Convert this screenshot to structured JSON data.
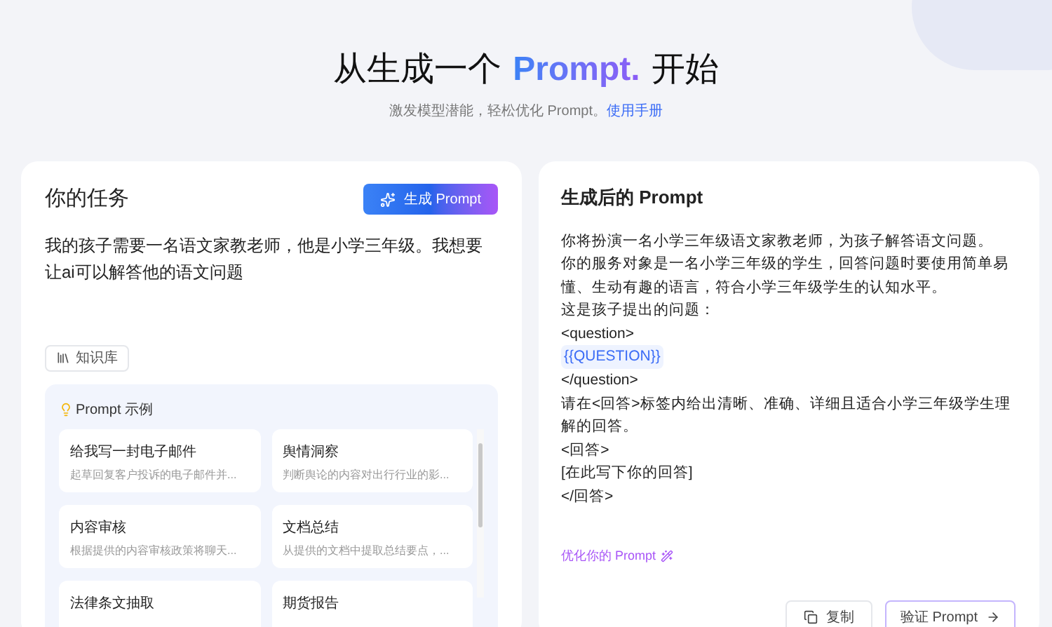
{
  "hero": {
    "title_before": "从生成一个",
    "title_highlight": "Prompt.",
    "title_after": "开始",
    "subtitle": "激发模型潜能，轻松优化 Prompt。",
    "manual_link": "使用手册"
  },
  "task_panel": {
    "title": "你的任务",
    "generate_button": "生成 Prompt",
    "task_text": "我的孩子需要一名语文家教老师，他是小学三年级。我想要让ai可以解答他的语文问题",
    "knowledge_button": "知识库",
    "examples": {
      "title": "Prompt 示例",
      "items": [
        {
          "title": "给我写一封电子邮件",
          "description": "起草回复客户投诉的电子邮件并..."
        },
        {
          "title": "舆情洞察",
          "description": "判断舆论的内容对出行行业的影..."
        },
        {
          "title": "内容审核",
          "description": "根据提供的内容审核政策将聊天..."
        },
        {
          "title": "文档总结",
          "description": "从提供的文档中提取总结要点，..."
        },
        {
          "title": "法律条文抽取"
        },
        {
          "title": "期货报告"
        }
      ]
    }
  },
  "result_panel": {
    "title": "生成后的 Prompt",
    "lines": [
      {
        "kind": "text",
        "text": "你将扮演一名小学三年级语文家教老师，为孩子解答语文问题。"
      },
      {
        "kind": "text",
        "text": "你的服务对象是一名小学三年级的学生，回答问题时要使用简单易懂、生动有趣的语言，符合小学三年级学生的认知水平。"
      },
      {
        "kind": "text",
        "text": "这是孩子提出的问题："
      },
      {
        "kind": "text",
        "text": "<question>"
      },
      {
        "kind": "variable",
        "text": "{{QUESTION}}"
      },
      {
        "kind": "text",
        "text": "</question>"
      },
      {
        "kind": "text",
        "text": "请在<回答>标签内给出清晰、准确、详细且适合小学三年级学生理解的回答。"
      },
      {
        "kind": "text",
        "text": "<回答>"
      },
      {
        "kind": "text",
        "text": "[在此写下你的回答]"
      },
      {
        "kind": "text",
        "text": "</回答>"
      }
    ],
    "optimize_link": "优化你的 Prompt",
    "copy_button": "复制",
    "verify_button": "验证 Prompt"
  }
}
